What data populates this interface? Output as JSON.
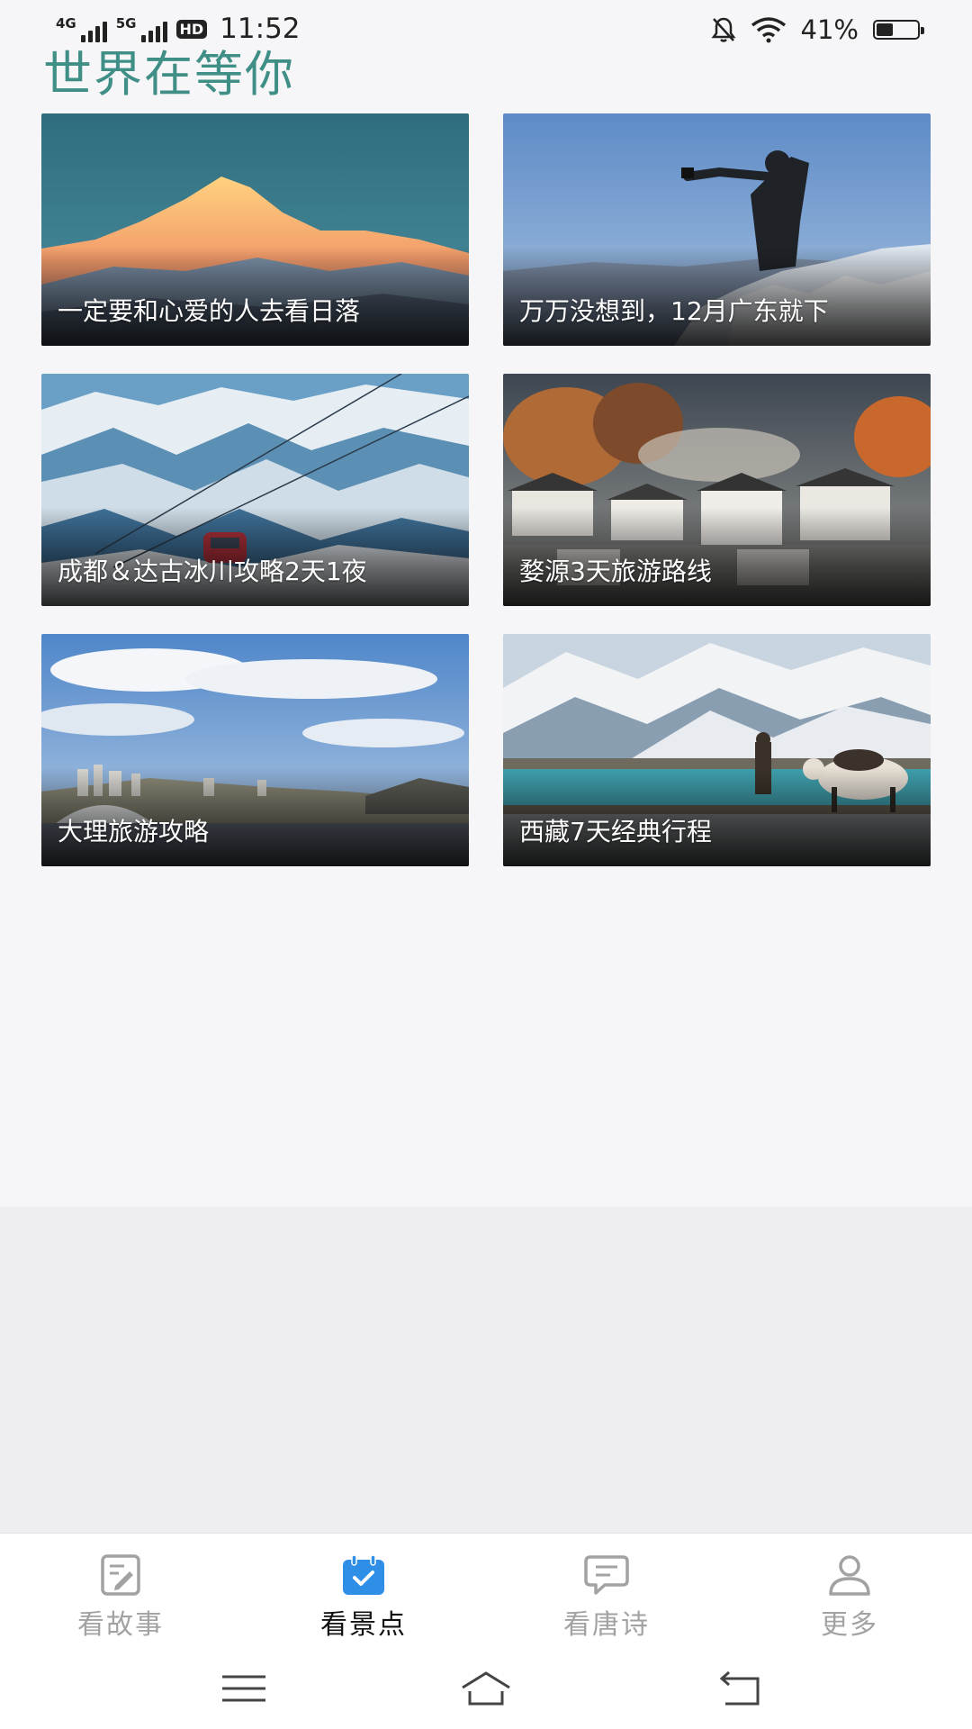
{
  "status_bar": {
    "signal1": "4G",
    "signal2": "5G",
    "hd": "HD",
    "time": "11:52",
    "battery_percent": "41%",
    "battery_level": 0.41,
    "icons": [
      "mute-bell-icon",
      "wifi-icon",
      "battery-icon"
    ]
  },
  "page": {
    "title": "世界在等你"
  },
  "cards": [
    {
      "caption": "一定要和心爱的人去看日落",
      "scene": "sunset-snow-mountain"
    },
    {
      "caption": "万万没想到，12月广东就下",
      "scene": "person-photographing-frost"
    },
    {
      "caption": "成都＆达古冰川攻略2天1夜",
      "scene": "snowy-mountains-cable-car"
    },
    {
      "caption": "婺源3天旅游路线",
      "scene": "village-autumn-trees"
    },
    {
      "caption": "大理旅游攻略",
      "scene": "city-blue-sky-clouds"
    },
    {
      "caption": "西藏7天经典行程",
      "scene": "lake-yak-snow-mountain"
    }
  ],
  "bottom_nav": [
    {
      "label": "看故事",
      "icon": "edit-note-icon",
      "active": false
    },
    {
      "label": "看景点",
      "icon": "calendar-check-icon",
      "active": true
    },
    {
      "label": "看唐诗",
      "icon": "chat-bubble-icon",
      "active": false
    },
    {
      "label": "更多",
      "icon": "person-icon",
      "active": false
    }
  ],
  "colors": {
    "title": "#3f8f86",
    "active_tab_icon": "#2f8fe6",
    "inactive_tab": "#a2a2a2",
    "active_tab_label": "#111111"
  }
}
